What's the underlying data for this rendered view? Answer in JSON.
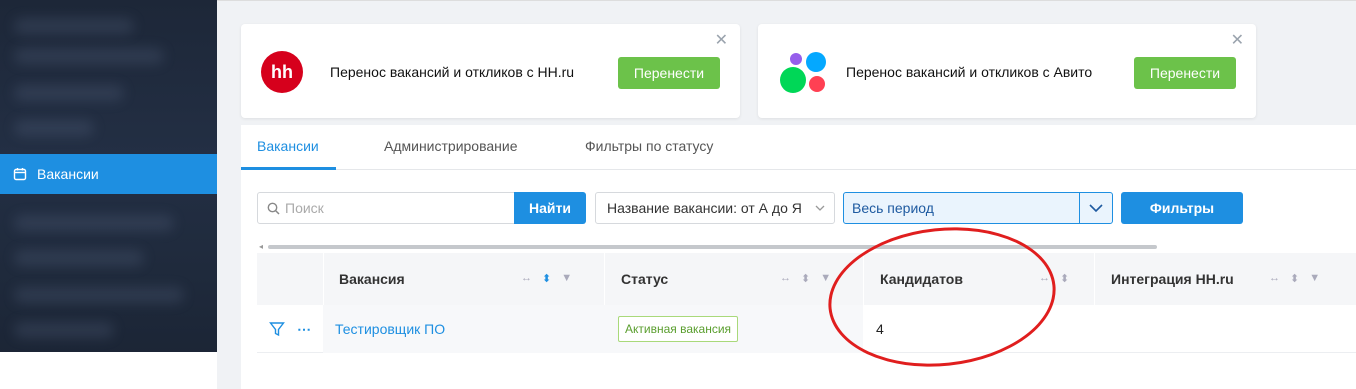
{
  "sidebar": {
    "active_item": {
      "icon": "calendar-icon",
      "label": "Вакансии"
    }
  },
  "promos": [
    {
      "icon": "hh-logo",
      "title": "Перенос вакансий и откликов с HH.ru",
      "button": "Перенести",
      "close": "✕"
    },
    {
      "icon": "avito-logo",
      "title": "Перенос вакансий и откликов с Авито",
      "button": "Перенести",
      "close": "✕"
    }
  ],
  "tabs": [
    {
      "label": "Вакансии",
      "active": true
    },
    {
      "label": "Администрирование",
      "active": false
    },
    {
      "label": "Фильтры по статусу",
      "active": false
    }
  ],
  "toolbar": {
    "search_placeholder": "Поиск",
    "find_label": "Найти",
    "sort_value": "Название вакансии: от А до Я",
    "period_value": "Весь период",
    "filters_label": "Фильтры"
  },
  "table": {
    "columns": [
      "Вакансия",
      "Статус",
      "Кандидатов",
      "Интеграция HH.ru"
    ],
    "rows": [
      {
        "vacancy": "Тестировщик ПО",
        "status": "Активная вакансия",
        "candidates": "4",
        "integration": ""
      }
    ]
  },
  "colors": {
    "accent": "#1e8fe1",
    "green_button": "#6cc24a",
    "hh_red": "#d6001c",
    "annotation_red": "#e01e1e"
  }
}
